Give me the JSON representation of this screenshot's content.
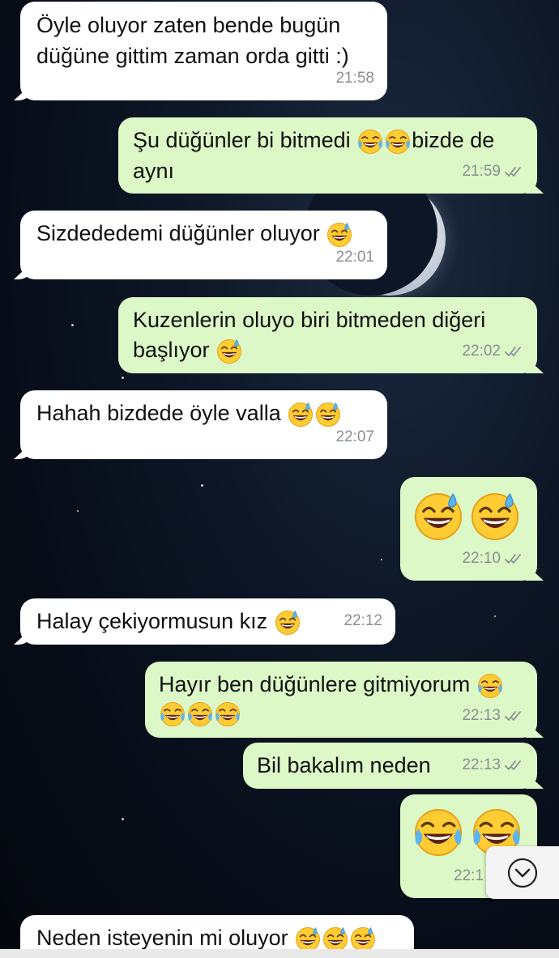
{
  "colors": {
    "incoming_bubble": "#ffffff",
    "outgoing_bubble": "#dcf8c6",
    "timestamp": "#8a8f94"
  },
  "icons": {
    "read_receipt": "double-check-icon",
    "emoji_tears_of_joy": "face-with-tears-of-joy-icon",
    "emoji_sweat_smile": "grinning-face-with-sweat-icon",
    "scroll_down": "chevron-down-icon"
  },
  "messages": [
    {
      "direction": "in",
      "lines": [
        "Öyle oluyor zaten bende bugün",
        "düğüne gittim zaman orda gitti :)"
      ],
      "time": "21:58"
    },
    {
      "direction": "out",
      "line1": "Şu düğünler bi bitmedi",
      "line1_end": "bizde de",
      "line2": "aynı",
      "time": "21:59"
    },
    {
      "direction": "in",
      "text": "Sizdededemi düğünler oluyor",
      "time": "22:01"
    },
    {
      "direction": "out",
      "lines": [
        "Kuzenlerin oluyo biri bitmeden diğeri",
        "başlıyor"
      ],
      "time": "22:02"
    },
    {
      "direction": "in",
      "text": "Hahah bizdede öyle valla",
      "time": "22:07"
    },
    {
      "direction": "out",
      "emoji_only": true,
      "time": "22:10"
    },
    {
      "direction": "in",
      "text": "Halay çekiyormusun kız",
      "time": "22:12"
    },
    {
      "direction": "out",
      "text": "Hayır ben düğünlere gitmiyorum",
      "time": "22:13"
    },
    {
      "direction": "out",
      "text": "Bil bakalım neden",
      "time": "22:13"
    },
    {
      "direction": "out",
      "emoji_only": true,
      "time": "22:1"
    },
    {
      "direction": "in",
      "text": "Neden isteyenin mi oluyor"
    }
  ]
}
